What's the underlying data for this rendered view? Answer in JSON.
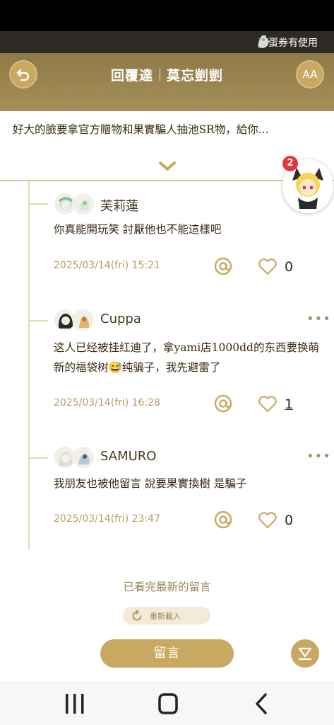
{
  "ticker": {
    "text": "轉蛋券有使用"
  },
  "header": {
    "title_left": "回覆達",
    "title_right": "莫忘剴剴",
    "font_button_label": "AA"
  },
  "post": {
    "excerpt": "好大的臉要拿官方贈物和果實騙人抽池SR物，給你..."
  },
  "notification": {
    "count": "2"
  },
  "comments": [
    {
      "name": "芙莉蓮",
      "text": "你真能開玩笑 討厭他也不能這樣吧",
      "date": "2025/03/14(fri) 15:21",
      "likes": "0"
    },
    {
      "name": "Cuppa",
      "text": "这人已经被挂红迪了，拿yami店1000dd的东西要换萌新的福袋树😅纯骗子，我先避雷了",
      "date": "2025/03/14(fri) 16:28",
      "likes": "1"
    },
    {
      "name": "SAMURO",
      "text": "我朋友也被他留言 說要果實換樹 是騙子",
      "date": "2025/03/14(fri) 23:47",
      "likes": "0"
    }
  ],
  "footer": {
    "seen_text": "已看完最新的留言",
    "reload_label": "重新載入",
    "comment_button": "留言"
  },
  "colors": {
    "accent": "#c9a862",
    "header": "#9c8550",
    "date_text": "#b89c62",
    "badge": "#e2383b"
  },
  "icons": [
    "back-icon",
    "font-size-icon",
    "chevron-down-icon",
    "at-icon",
    "heart-icon",
    "more-icon",
    "reload-icon",
    "scroll-bottom-icon",
    "recent-apps-icon",
    "home-icon",
    "back-nav-icon"
  ]
}
